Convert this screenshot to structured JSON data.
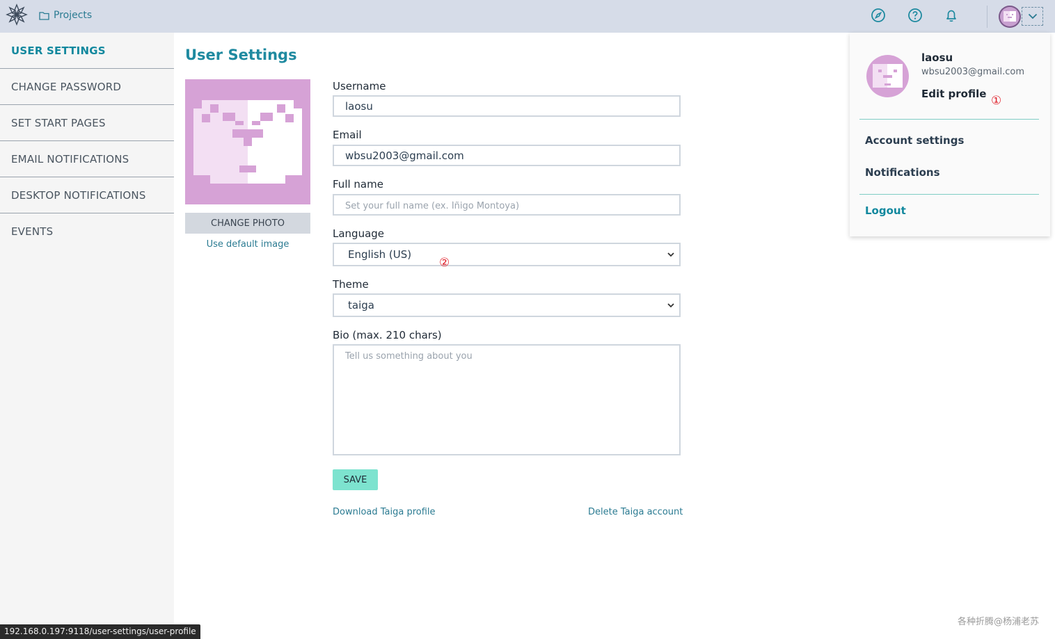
{
  "nav": {
    "projects_label": "Projects",
    "icons": [
      "compass-icon",
      "help-icon",
      "bell-icon"
    ]
  },
  "sidebar": {
    "items": [
      {
        "label": "USER SETTINGS",
        "active": true
      },
      {
        "label": "CHANGE PASSWORD"
      },
      {
        "label": "SET START PAGES"
      },
      {
        "label": "EMAIL NOTIFICATIONS"
      },
      {
        "label": "DESKTOP NOTIFICATIONS"
      },
      {
        "label": "EVENTS"
      }
    ]
  },
  "main": {
    "title": "User Settings",
    "change_photo_label": "CHANGE PHOTO",
    "default_image_label": "Use default image",
    "username_label": "Username",
    "username_value": "laosu",
    "email_label": "Email",
    "email_value": "wbsu2003@gmail.com",
    "fullname_label": "Full name",
    "fullname_placeholder": "Set your full name (ex. Íñigo Montoya)",
    "language_label": "Language",
    "language_value": "English (US)",
    "theme_label": "Theme",
    "theme_value": "taiga",
    "bio_label": "Bio (max. 210 chars)",
    "bio_placeholder": "Tell us something about you",
    "save_label": "SAVE",
    "download_label": "Download Taiga profile",
    "delete_label": "Delete Taiga account"
  },
  "dropdown": {
    "username": "laosu",
    "email": "wbsu2003@gmail.com",
    "edit_profile": "Edit profile",
    "account_settings": "Account settings",
    "notifications": "Notifications",
    "logout": "Logout"
  },
  "annotations": {
    "marker1": "①",
    "marker2": "②"
  },
  "status_url": "192.168.0.197:9118/user-settings/user-profile",
  "watermark": "各种折腾@杨浦老苏",
  "colors": {
    "accent": "#11889e",
    "save_button": "#7de3cf",
    "topbar": "#d6dce8",
    "avatar_bg": "#d6a2d6"
  }
}
